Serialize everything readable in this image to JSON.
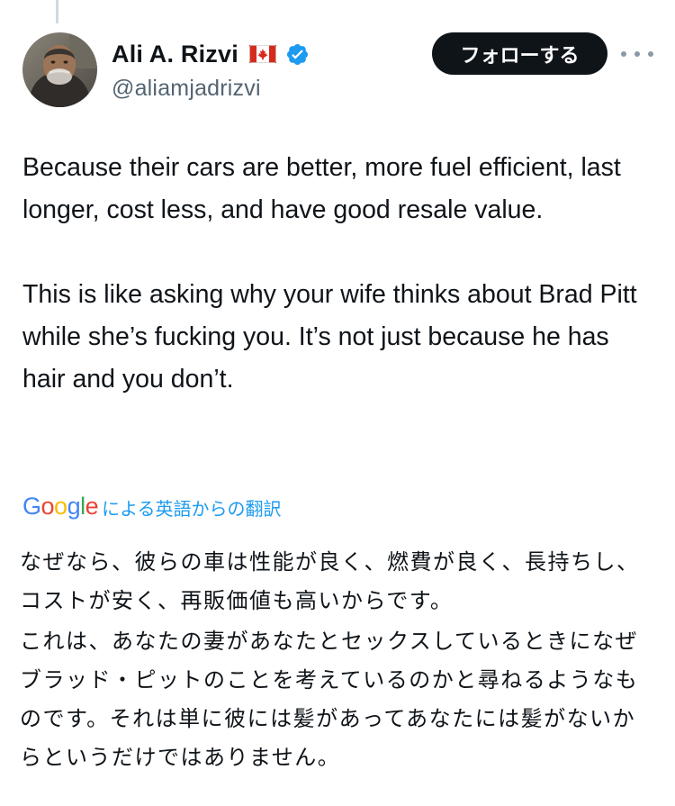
{
  "author": {
    "display_name": "Ali A. Rizvi",
    "handle": "@aliamjadrizvi",
    "flag_icon": "canada-flag-icon",
    "verified_icon": "verified-badge-icon",
    "verified_color": "#1d9bf0"
  },
  "actions": {
    "follow_label": "フォローする",
    "more_icon": "more-options-icon"
  },
  "tweet": {
    "paragraphs": [
      "Because their cars are better, more fuel efficient, last longer, cost less, and have good resale value.",
      "This is like asking why your wife thinks about Brad Pitt while she’s fucking you. It’s not just because he has hair and you don’t."
    ]
  },
  "translation": {
    "logo_text": "Google",
    "label": "による英語からの翻訳",
    "paragraphs": [
      "なぜなら、彼らの車は性能が良く、燃費が良く、長持ちし、コストが安く、再販価値も高いからです。",
      "これは、あなたの妻があなたとセックスしているときになぜブラッド・ピットのことを考えているのかと尋ねるようなものです。それは単に彼には髪があってあなたには髪がないからというだけではありません。"
    ]
  }
}
